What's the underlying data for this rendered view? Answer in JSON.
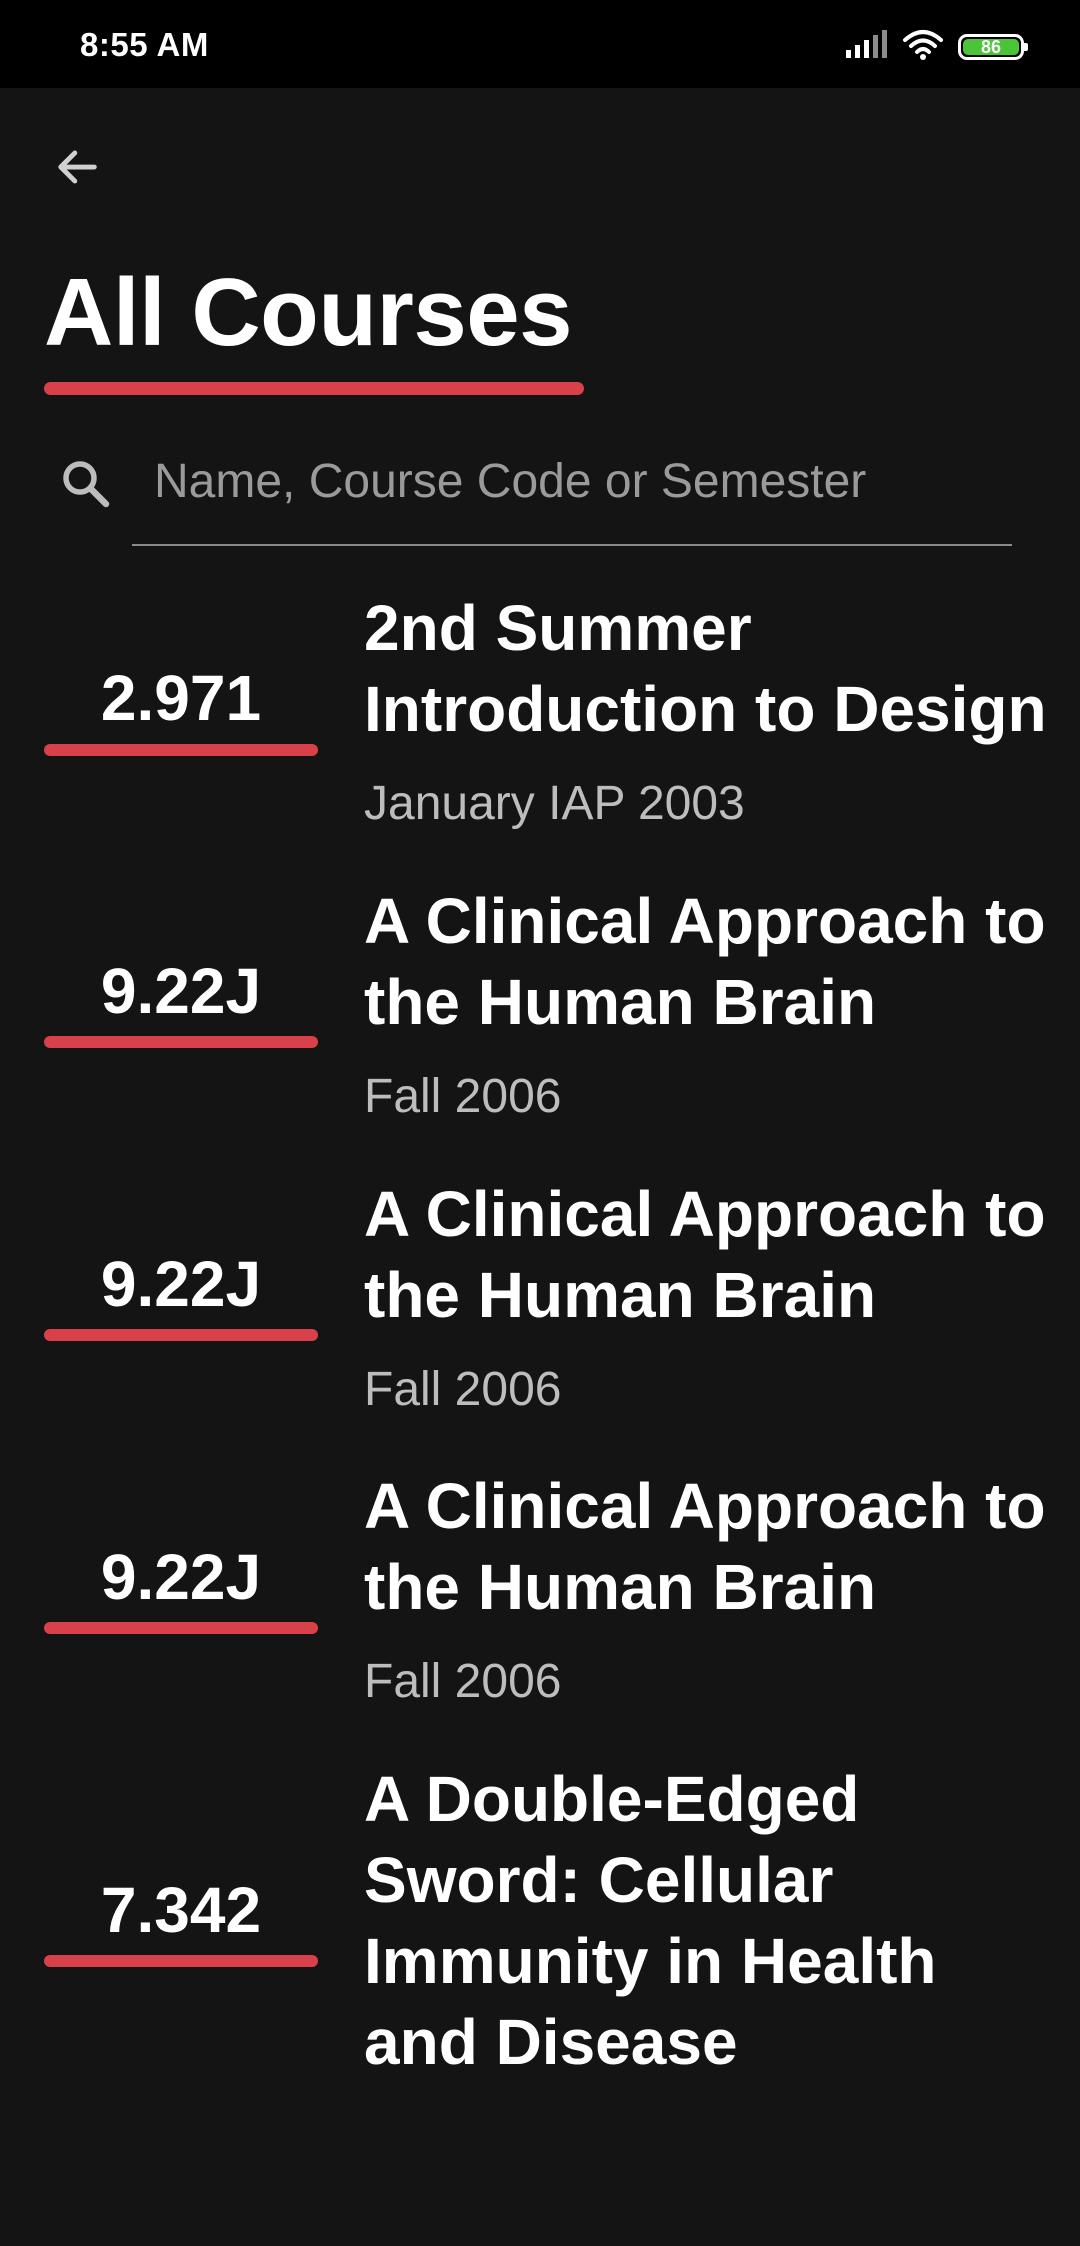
{
  "status_bar": {
    "time": "8:55 AM",
    "battery": "86",
    "icons": [
      "signal-icon",
      "wifi-icon",
      "battery-icon"
    ]
  },
  "colors": {
    "background": "#141414",
    "accent": "#d8404a",
    "status_bar": "#000000",
    "battery_fill": "#4bc43a"
  },
  "header": {
    "back_icon": "arrow-left-icon",
    "title": "All Courses"
  },
  "search": {
    "icon": "search-icon",
    "value": "",
    "placeholder": "Name, Course Code or Semester"
  },
  "courses": [
    {
      "code": "2.971",
      "name": "2nd Summer Introduction to Design",
      "term": "January IAP 2003"
    },
    {
      "code": "9.22J",
      "name": "A Clinical Approach to the Human Brain",
      "term": "Fall 2006"
    },
    {
      "code": "9.22J",
      "name": "A Clinical Approach to the Human Brain",
      "term": "Fall 2006"
    },
    {
      "code": "9.22J",
      "name": "A Clinical Approach to the Human Brain",
      "term": "Fall 2006"
    },
    {
      "code": "7.342",
      "name": "A Double-Edged Sword: Cellular Immunity in Health and Disease",
      "term": ""
    }
  ]
}
